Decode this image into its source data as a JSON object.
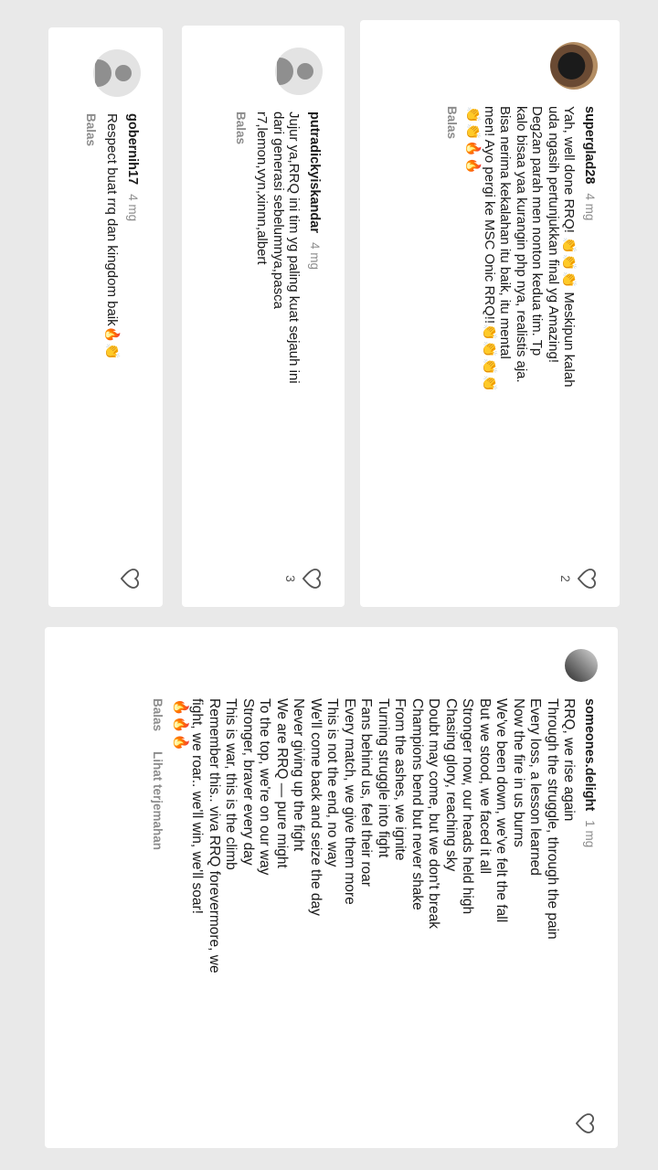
{
  "comments": [
    {
      "username": "superglad28",
      "time": "4 mg",
      "text": "Yah, well done RRQ! 👏👏👏 Meskipun kalah\nuda ngasih pertunjukkan final yg Amazing!\nDeg2an parah men nonton kedua tim. Tp\nkalo bisaa yaa kurangin php nya, realistis aja.\nBisa nerima kekalahan itu baik, itu mental\nmen! Ayo pergi ke MSC Onic RRQ!!👏👏👏👏\n👏👏🔥🔥",
      "reply_label": "Balas",
      "likes": "2",
      "avatar": "cat-photo"
    },
    {
      "username": "putradickyiskandar",
      "time": "4 mg",
      "text": "Jujur ya,RRQ ini tim yg paling kuat sejauh ini\ndari generasi sebelumnya,pasca\nr7,lemon,vyn,xinnn,albert",
      "reply_label": "Balas",
      "likes": "3",
      "avatar": "default-avatar"
    },
    {
      "username": "gobernih17",
      "time": "4 mg",
      "text": "Respect buat rrq dan kingdom baik🔥👏",
      "reply_label": "Balas",
      "likes": "",
      "avatar": "default-avatar"
    },
    {
      "username": "someones.delight",
      "time": "1 mg",
      "text": "RRQ, we rise again\nThrough the struggle, through the pain\nEvery loss, a lesson learned\nNow the fire in us burns\nWe've been down, we've felt the fall\nBut we stood, we faced it all\nStronger now, our heads held high\nChasing glory, reaching sky\nDoubt may come, but we don't break\nChampions bend but never shake\nFrom the ashes, we ignite\nTurning struggle into fight\nFans behind us, feel their roar\nEvery match, we give them more\nThis is not the end, no way\nWe'll come back and seize the day\nNever giving up the fight\nWe are RRQ — pure might\nTo the top, we're on our way\nStronger, braver every day\nThis is war, this is the climb\nRemember this.. viva RRQ forevermore, we\nfight, we roar.. we'll win, we'll soar!\n🔥🔥🔥",
      "reply_label": "Balas",
      "translate_label": "Lihat terjemahan",
      "likes": "",
      "avatar": "person-photo"
    }
  ]
}
